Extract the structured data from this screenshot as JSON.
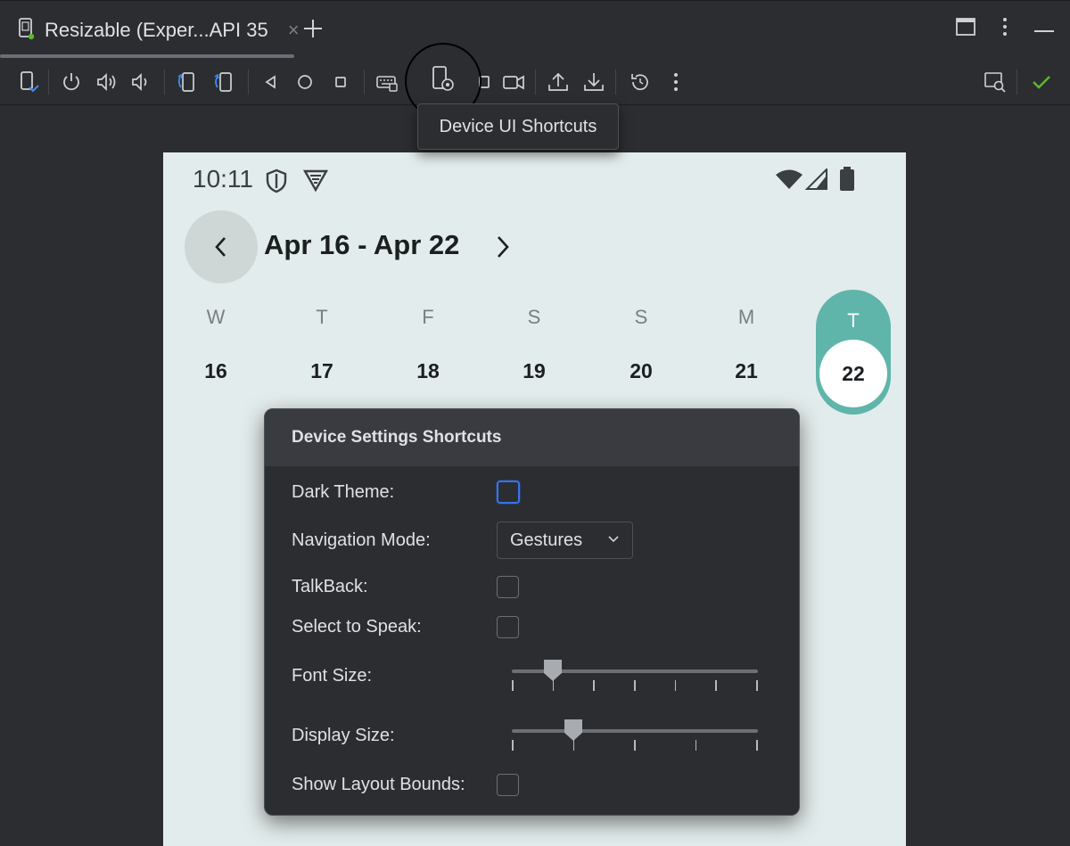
{
  "tab": {
    "title": "Resizable (Exper...API 35",
    "close_glyph": "×",
    "icon": "device-tab-icon"
  },
  "window_controls": [
    "maximize-icon",
    "more-vert-icon",
    "minimize-icon"
  ],
  "toolbar": {
    "icons": [
      "device-mirror-icon",
      "power-icon",
      "volume-up-icon",
      "volume-down-icon",
      "rotate-left-icon",
      "rotate-right-icon",
      "back-icon",
      "home-icon",
      "overview-icon",
      "keyboard-icon",
      "device-ui-shortcuts-icon",
      "screenshot-icon",
      "screen-record-icon",
      "upload-icon",
      "download-icon",
      "snapshot-icon",
      "more-vert-icon",
      "layout-inspector-icon",
      "check-icon"
    ],
    "tooltip": "Device UI Shortcuts"
  },
  "device": {
    "status_time": "10:11",
    "range_title": "Apr 16 - Apr 22",
    "days": [
      {
        "letter": "W",
        "num": "16"
      },
      {
        "letter": "T",
        "num": "17"
      },
      {
        "letter": "F",
        "num": "18"
      },
      {
        "letter": "S",
        "num": "19"
      },
      {
        "letter": "S",
        "num": "20"
      },
      {
        "letter": "M",
        "num": "21"
      }
    ],
    "today": {
      "letter": "T",
      "num": "22"
    },
    "accent_color": "#5fb5aa"
  },
  "popup": {
    "title": "Device Settings Shortcuts",
    "dark_theme_label": "Dark Theme:",
    "dark_theme_checked": false,
    "navigation_mode_label": "Navigation Mode:",
    "navigation_mode_value": "Gestures",
    "talkback_label": "TalkBack:",
    "talkback_checked": false,
    "select_to_speak_label": "Select to Speak:",
    "select_to_speak_checked": false,
    "font_size_label": "Font Size:",
    "font_size": {
      "steps": 7,
      "value_index": 1
    },
    "display_size_label": "Display Size:",
    "display_size": {
      "steps": 5,
      "value_index": 1
    },
    "show_layout_bounds_label": "Show Layout Bounds:",
    "show_layout_bounds_checked": false
  }
}
